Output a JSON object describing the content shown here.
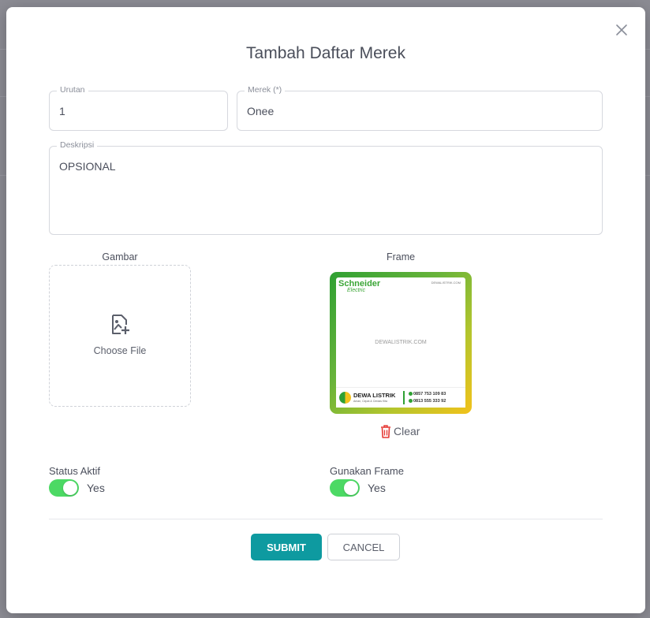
{
  "modal": {
    "title": "Tambah Daftar Merek"
  },
  "fields": {
    "urutan": {
      "label": "Urutan",
      "value": "1"
    },
    "merek": {
      "label": "Merek (*)",
      "value": "Onee"
    },
    "deskripsi": {
      "label": "Deskripsi",
      "value": "OPSIONAL"
    }
  },
  "gambar": {
    "label": "Gambar",
    "choose_file": "Choose File"
  },
  "frame": {
    "label": "Frame",
    "preview": {
      "brand": "Schneider",
      "brand_sub": "Electric",
      "site_top": "DEWALISTRIK.COM",
      "watermark": "DEWALISTRIK.COM",
      "store_name": "DEWA LISTRIK",
      "store_tag": "Aman, Cepat & Cerdas Kita",
      "phone_1": "0857 753 109 83",
      "phone_2": "0813 555 333 92",
      "gradient_colors": [
        "#2fa033",
        "#f2c21b"
      ]
    },
    "clear_label": "Clear"
  },
  "status_aktif": {
    "label": "Status Aktif",
    "toggle_text": "Yes",
    "on": true
  },
  "gunakan_frame": {
    "label": "Gunakan Frame",
    "toggle_text": "Yes",
    "on": true
  },
  "actions": {
    "submit": "SUBMIT",
    "cancel": "CANCEL"
  },
  "colors": {
    "accent": "#0e9aa0",
    "toggle_on": "#4cd964",
    "danger": "#e53935"
  }
}
